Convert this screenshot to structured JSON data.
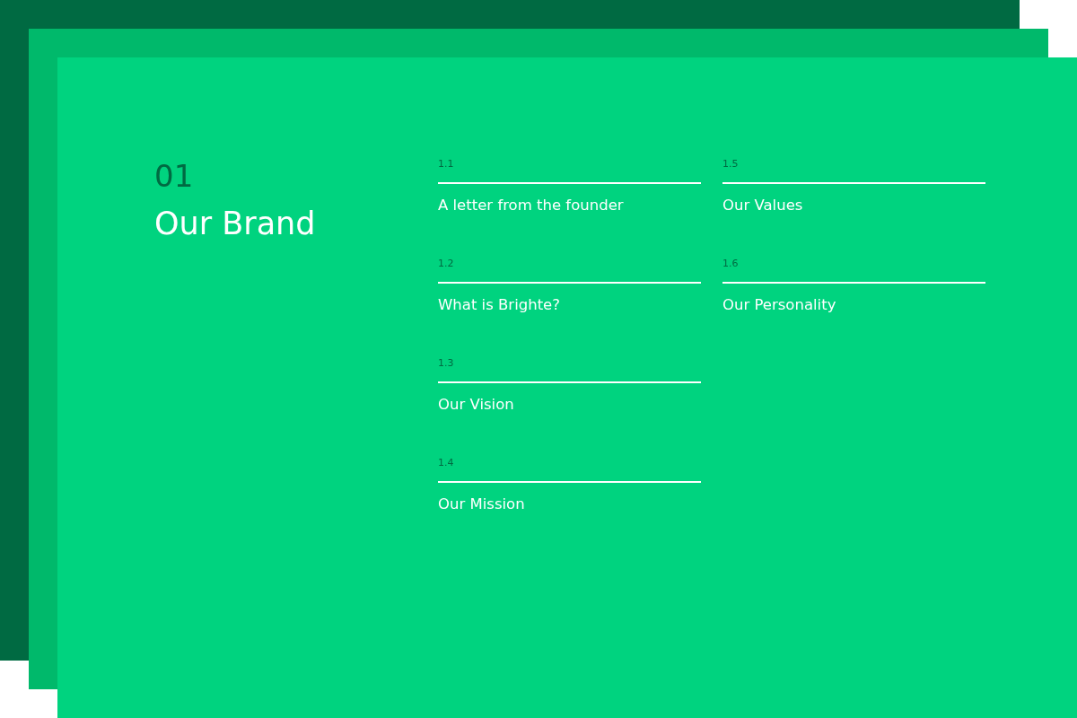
{
  "section": {
    "number": "01",
    "title": "Our Brand"
  },
  "items": [
    {
      "number": "1.1",
      "title": "A letter from the founder"
    },
    {
      "number": "1.2",
      "title": "What is Brighte?"
    },
    {
      "number": "1.3",
      "title": "Our Vision"
    },
    {
      "number": "1.4",
      "title": "Our Mission"
    },
    {
      "number": "1.5",
      "title": "Our Values"
    },
    {
      "number": "1.6",
      "title": "Our Personality"
    }
  ]
}
